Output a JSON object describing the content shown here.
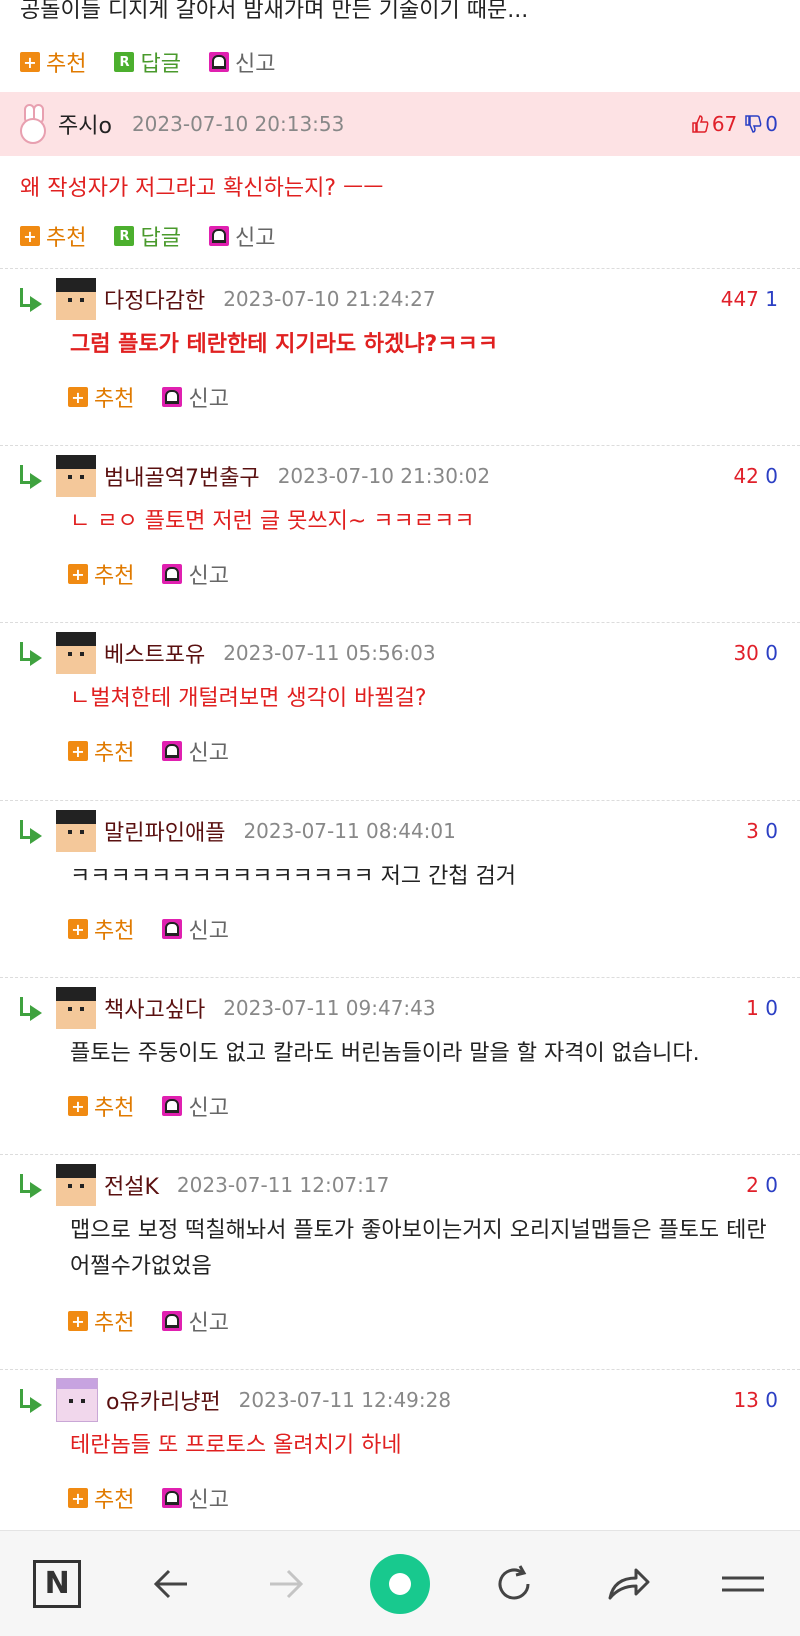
{
  "top_comment": {
    "text": "공돌이들 디지게 갈아서 밤새가며 만든 기술이기 때문...",
    "actions": {
      "recommend": "추천",
      "reply": "답글",
      "report": "신고"
    }
  },
  "main_comment": {
    "author": "주시o",
    "date": "2023-07-10 20:13:53",
    "up": "67",
    "down": "0",
    "text": "왜 작성자가 저그라고 확신하는지? ㅡㅡ",
    "actions": {
      "recommend": "추천",
      "reply": "답글",
      "report": "신고"
    }
  },
  "replies": [
    {
      "author": "다정다감한",
      "date": "2023-07-10 21:24:27",
      "up": "447",
      "down": "1",
      "text": "그럼 플토가 테란한테 지기라도 하겠냐?ㅋㅋㅋ",
      "recommend": "추천",
      "report": "신고"
    },
    {
      "author": "범내골역7번출구",
      "date": "2023-07-10 21:30:02",
      "up": "42",
      "down": "0",
      "text": "ㄴ ㄹㅇ 플토면 저런 글 못쓰지~ ㅋㅋㄹㅋㅋ",
      "recommend": "추천",
      "report": "신고"
    },
    {
      "author": "베스트포유",
      "date": "2023-07-11 05:56:03",
      "up": "30",
      "down": "0",
      "text": "ㄴ벌쳐한테 개털려보면 생각이 바뀔걸?",
      "recommend": "추천",
      "report": "신고"
    },
    {
      "author": "말린파인애플",
      "date": "2023-07-11 08:44:01",
      "up": "3",
      "down": "0",
      "text": "ㅋㅋㅋㅋㅋㅋㅋㅋㅋㅋㅋㅋㅋㅋㅋ 저그 간첩 검거",
      "recommend": "추천",
      "report": "신고"
    },
    {
      "author": "책사고싶다",
      "date": "2023-07-11 09:47:43",
      "up": "1",
      "down": "0",
      "text": "플토는 주둥이도 없고 칼라도 버린놈들이라 말을 할 자격이 없습니다.",
      "recommend": "추천",
      "report": "신고"
    },
    {
      "author": "전설K",
      "date": "2023-07-11 12:07:17",
      "up": "2",
      "down": "0",
      "text": "맵으로 보정 떡칠해놔서 플토가 좋아보이는거지 오리지널맵들은 플토도 테란 어쩔수가없었음",
      "recommend": "추천",
      "report": "신고"
    },
    {
      "author": "o유카리냥펀",
      "date": "2023-07-11 12:49:28",
      "up": "13",
      "down": "0",
      "text": "테란놈들 또 프로토스 올려치기 하네",
      "recommend": "추천",
      "report": "신고"
    }
  ],
  "nav": {
    "n_label": "N"
  },
  "colors": {
    "up": "#e0202a",
    "down": "#2b3fc4",
    "accent_green": "#18c98e",
    "pink_header": "#fde2e4"
  }
}
